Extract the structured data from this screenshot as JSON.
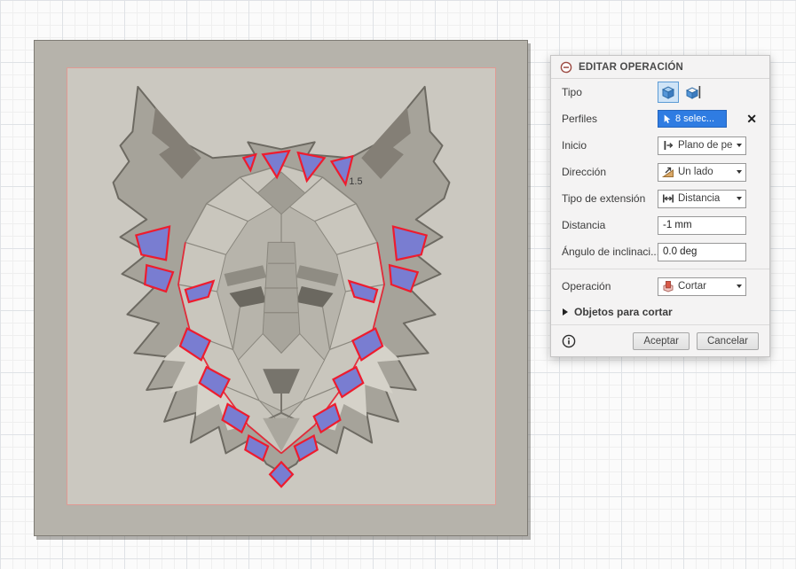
{
  "viewport": {
    "dimension_label": "1.5"
  },
  "colors": {
    "selection_blue": "#2f7ce2",
    "profile_fill": "#797dd1",
    "profile_outline": "#ee1c2e",
    "sketch_border": "#e09a93"
  },
  "dialog": {
    "title": "EDITAR OPERACIÓN",
    "tipo": {
      "label": "Tipo"
    },
    "perfiles": {
      "label": "Perfiles",
      "value": "8 selec...",
      "clear_label": "✕"
    },
    "inicio": {
      "label": "Inicio",
      "value": "Plano de pe..."
    },
    "direccion": {
      "label": "Dirección",
      "value": "Un lado"
    },
    "extension": {
      "label": "Tipo de extensión",
      "value": "Distancia"
    },
    "distancia": {
      "label": "Distancia",
      "value": "-1 mm"
    },
    "angulo": {
      "label": "Ángulo de inclinaci...",
      "value": "0.0 deg"
    },
    "operacion": {
      "label": "Operación",
      "value": "Cortar"
    },
    "objetos": {
      "label": "Objetos para cortar"
    },
    "footer": {
      "aceptar": "Aceptar",
      "cancelar": "Cancelar"
    }
  }
}
